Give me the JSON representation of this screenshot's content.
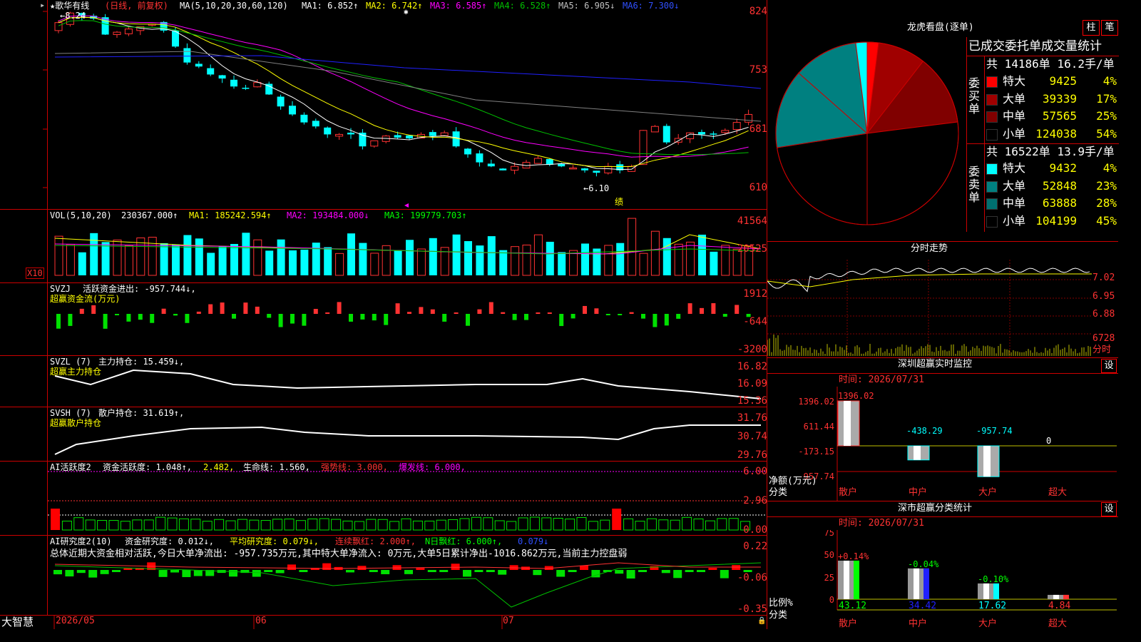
{
  "colors": {
    "up": "#ff3232",
    "down": "#00ffff",
    "frame": "#cc0000",
    "ma1": "#ffffff",
    "ma2": "#ffff00",
    "ma3": "#ff00ff",
    "ma4": "#00c000",
    "ma5": "#808080",
    "ma6": "#2020ff"
  },
  "main": {
    "stock_name": "★歌华有线",
    "mode": "(日线, 前复权)",
    "ma_label": "MA(5,10,20,30,60,120)",
    "ma_items": [
      {
        "text": "MA1: 6.852↑",
        "color": "#ffffff"
      },
      {
        "text": "MA2: 6.742↑",
        "color": "#ffff00"
      },
      {
        "text": "MA3: 6.585↑",
        "color": "#ff00ff"
      },
      {
        "text": "MA4: 6.528↑",
        "color": "#00c000"
      },
      {
        "text": "MA5: 6.905↓",
        "color": "#c0c0c0"
      },
      {
        "text": "MA6: 7.300↓",
        "color": "#3050ff"
      }
    ],
    "high_marker": "8.24",
    "low_marker": "←6.10",
    "note_char": "绩",
    "y_ticks": [
      "824",
      "753",
      "681",
      "610"
    ]
  },
  "vol": {
    "title": "VOL(5,10,20)",
    "value": "230367.000↑",
    "ma1": "MA1: 185242.594↑",
    "ma2": "MA2: 193484.000↓",
    "ma3": "MA3: 199779.703↑",
    "y_ticks": [
      "41564",
      "20525"
    ],
    "unit": "X10"
  },
  "svzj": {
    "title": "SVZJ",
    "label": "活跃资金进出: -957.744↓,",
    "sub": "超赢资金流(万元)",
    "y_ticks": [
      "1912",
      "-644",
      "-3200"
    ]
  },
  "svzl": {
    "title": "SVZL (7)",
    "label": "主力持仓: 15.459↓,",
    "sub": "超赢主力持仓",
    "y_ticks": [
      "16.82",
      "16.09",
      "15.36"
    ]
  },
  "svsh": {
    "title": "SVSH (7)",
    "label": "散户持仓: 31.619↑,",
    "sub": "超赢散户持仓",
    "y_ticks": [
      "31.76",
      "30.74",
      "29.76"
    ]
  },
  "ai1": {
    "title": "AI活跃度2",
    "label1": "资金活跃度: 1.048↑,",
    "label2": "2.482,",
    "label3": "生命线: 1.560,",
    "label4": "强势线: 3.000,",
    "label5": "爆发线: 6.000,",
    "y_ticks": [
      "6.00",
      "2.96",
      "0.00"
    ]
  },
  "ai2": {
    "title": "AI研究度2(10)",
    "label1": "资金研究度: 0.012↓,",
    "label2": "平均研究度: 0.079↓,",
    "label3": "连续飘红: 2.000↑,",
    "label4": "N日飘红: 6.000↑,",
    "label5": "0.079↓",
    "summary": "总体近期大资金相对活跃,今日大单净流出: -957.735万元,其中特大单净流入: 0万元,大单5日累计净出-1016.862万元,当前主力控盘弱",
    "y_ticks": [
      "0.22",
      "-0.06",
      "-0.35"
    ]
  },
  "footer": {
    "brand": "大智慧",
    "dates": [
      "2026/05",
      "06",
      "07"
    ]
  },
  "pie": {
    "title": "龙虎看盘(逐单)",
    "btn1": "柱",
    "btn2": "笔",
    "header": "已成交委托单成交量统计",
    "buy_label": "委买单",
    "sell_label": "委卖单",
    "buy_total": "共 14186单 16.2手/单",
    "sell_total": "共 16522单 13.9手/单",
    "buy_rows": [
      {
        "name": "特大",
        "vol": "9425",
        "pct": "4%",
        "color": "#ff0000"
      },
      {
        "name": "大单",
        "vol": "39339",
        "pct": "17%",
        "color": "#a00000"
      },
      {
        "name": "中单",
        "vol": "57565",
        "pct": "25%",
        "color": "#800000"
      },
      {
        "name": "小单",
        "vol": "124038",
        "pct": "54%",
        "color": "#000000"
      }
    ],
    "sell_rows": [
      {
        "name": "特大",
        "vol": "9432",
        "pct": "4%",
        "color": "#00ffff"
      },
      {
        "name": "大单",
        "vol": "52848",
        "pct": "23%",
        "color": "#008080"
      },
      {
        "name": "中单",
        "vol": "63888",
        "pct": "28%",
        "color": "#007070"
      },
      {
        "name": "小单",
        "vol": "104199",
        "pct": "45%",
        "color": "#000000"
      }
    ]
  },
  "intraday": {
    "title": "分时走势",
    "y_ticks": [
      "7.02",
      "6.95",
      "6.88"
    ],
    "vol_tick": "6728",
    "vol_unit": "分时"
  },
  "monitor": {
    "title": "深圳超赢实时监控",
    "gear": "设",
    "time": "时间: 2026/07/31",
    "y_ticks": [
      "1396.02",
      "611.44",
      "-173.15",
      "-957.74"
    ],
    "ylabel1": "净额(万元)",
    "ylabel2": "分类",
    "bars": [
      {
        "cat": "散户",
        "value": "1396.02",
        "v": 1396.02
      },
      {
        "cat": "中户",
        "value": "-438.29",
        "v": -438.29
      },
      {
        "cat": "大户",
        "value": "-957.74",
        "v": -957.74
      },
      {
        "cat": "超大",
        "value": "0",
        "v": 0
      }
    ]
  },
  "classify": {
    "title": "深市超赢分类统计",
    "gear": "设",
    "time": "时间: 2026/07/31",
    "y_ticks": [
      "75",
      "50",
      "25",
      "0"
    ],
    "ylabel1": "比例%",
    "ylabel2": "分类",
    "bars": [
      {
        "cat": "散户",
        "value": "43.12",
        "change": "+0.14%",
        "v": 43.12,
        "color": "#00ff00"
      },
      {
        "cat": "中户",
        "value": "34.42",
        "change": "-0.04%",
        "v": 34.42,
        "color": "#2020ff"
      },
      {
        "cat": "大户",
        "value": "17.62",
        "change": "-0.10%",
        "v": 17.62,
        "color": "#00ffff"
      },
      {
        "cat": "超大",
        "value": "4.84",
        "change": "",
        "v": 4.84,
        "color": "#ff3232"
      }
    ]
  }
}
